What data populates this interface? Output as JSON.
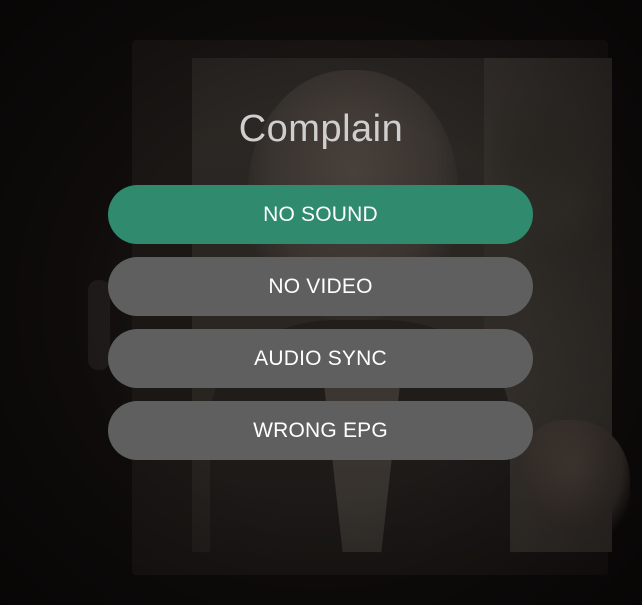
{
  "dialog": {
    "title": "Complain",
    "selected_index": 0,
    "options": [
      {
        "label": "NO SOUND"
      },
      {
        "label": "NO VIDEO"
      },
      {
        "label": "AUDIO SYNC"
      },
      {
        "label": "WRONG EPG"
      }
    ]
  },
  "colors": {
    "selected_option": "#2f8a6e",
    "option": "#5f5f5f",
    "option_text": "#ffffff",
    "title_text": "#cfcfcf",
    "background": "#0c0a09"
  }
}
